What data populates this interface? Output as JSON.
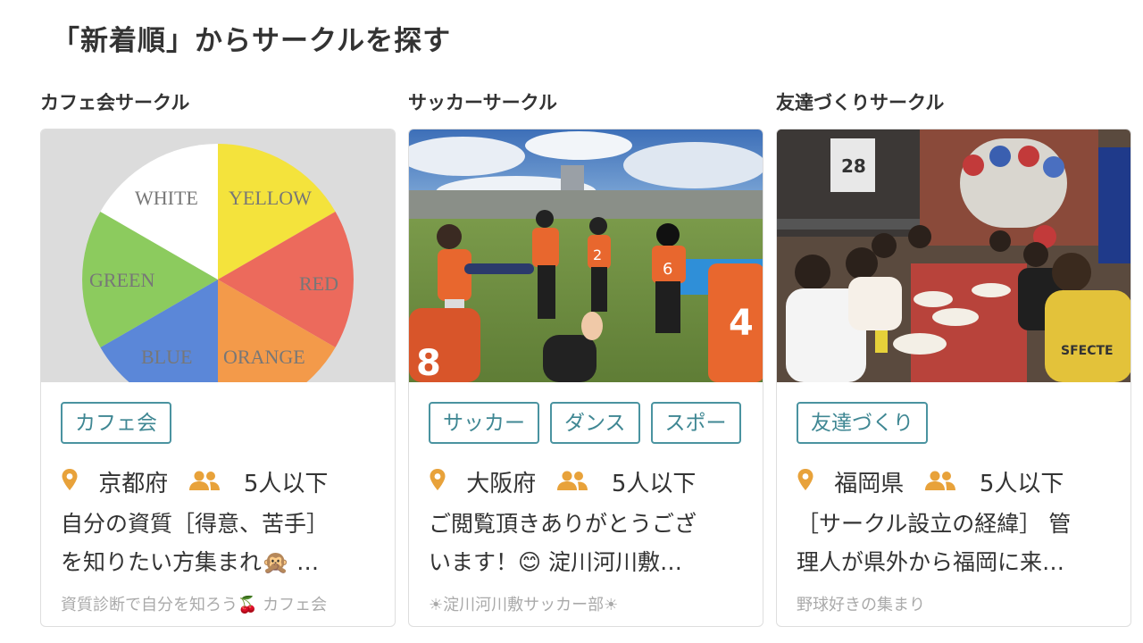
{
  "section": {
    "title": "「新着順」からサークルを探す"
  },
  "colors": {
    "tag_border": "#4a93a0",
    "icon_orange": "#e8a23a"
  },
  "cards": [
    {
      "category": "カフェ会サークル",
      "image_icon": "color-wheel-image",
      "wheel_labels": [
        "WHITE",
        "YELLOW",
        "RED",
        "ORANGE",
        "BLUE",
        "GREEN"
      ],
      "tags": [
        "カフェ会"
      ],
      "location": "京都府",
      "members": "5人以下",
      "desc_line1": "自分の資質［得意、苦手］",
      "desc_line2": "を知りたい方集まれ🙊 …",
      "footer": "資質診断で自分を知ろう🍒 カフェ会"
    },
    {
      "category": "サッカーサークル",
      "image_icon": "soccer-group-photo",
      "jersey_numbers": [
        "2",
        "6",
        "4",
        "8"
      ],
      "tags": [
        "サッカー",
        "ダンス",
        "スポー"
      ],
      "location": "大阪府",
      "members": "5人以下",
      "desc_line1": "ご閲覧頂きありがとうござ",
      "desc_line2": "います！😊 淀川河川敷…",
      "footer": "☀淀川河川敷サッカー部☀"
    },
    {
      "category": "友達づくりサークル",
      "image_icon": "restaurant-group-photo",
      "image_texts": [
        "28",
        "SFECTE"
      ],
      "tags": [
        "友達づくり"
      ],
      "location": "福岡県",
      "members": "5人以下",
      "desc_line1": "［サークル設立の経緯］ 管",
      "desc_line2": "理人が県外から福岡に来…",
      "footer": "野球好きの集まり"
    }
  ]
}
